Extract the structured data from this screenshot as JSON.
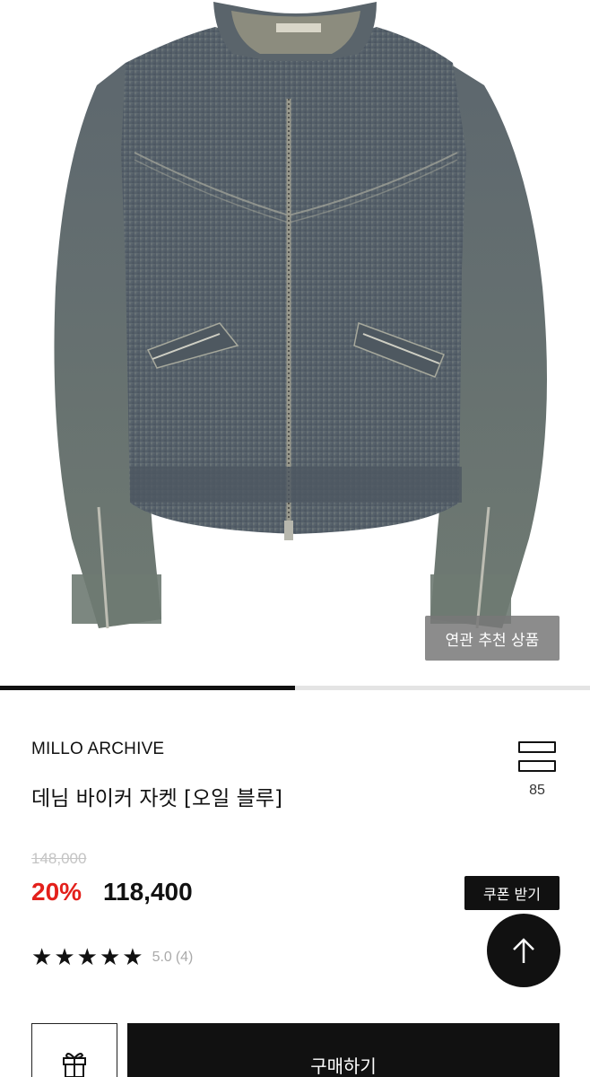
{
  "hero": {
    "image_alt": "denim biker jacket product photo",
    "related_button_label": "연관 추천 상품",
    "progress_fraction": 0.5
  },
  "product": {
    "brand": "MILLO ARCHIVE",
    "title": "데님 바이커 자켓 [오일 블루]",
    "original_price": "148,000",
    "discount": "20%",
    "price": "118,400",
    "coupon_label": "쿠폰 받기",
    "rating": {
      "stars": 5,
      "score": "5.0",
      "count": "(4)"
    },
    "wishlist_count": "85"
  },
  "actions": {
    "buy_label": "구매하기",
    "gift_icon": "gift-icon",
    "scroll_top_icon": "arrow-up-icon"
  },
  "colors": {
    "accent_red": "#e3201b",
    "primary_black": "#111111"
  }
}
